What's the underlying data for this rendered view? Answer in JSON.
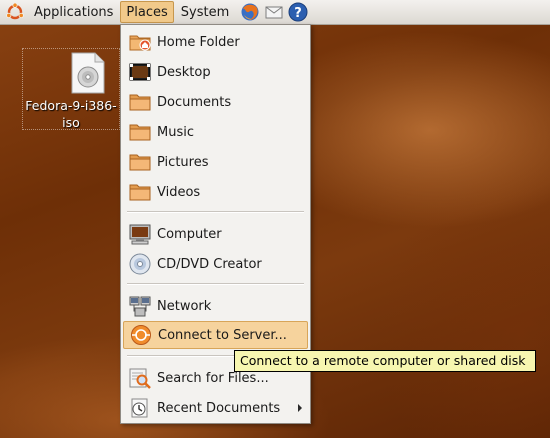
{
  "panel": {
    "applications_label": "Applications",
    "places_label": "Places",
    "system_label": "System",
    "launchers": [
      "firefox-icon",
      "mail-icon",
      "help-icon"
    ]
  },
  "desktop": {
    "icons": [
      {
        "label_line1": "Fedora-9-i386-",
        "label_line2": "iso",
        "icon": "disc-image-icon"
      }
    ]
  },
  "places_menu": {
    "items": [
      {
        "label": "Home Folder",
        "icon": "home-folder-icon"
      },
      {
        "label": "Desktop",
        "icon": "desktop-icon"
      },
      {
        "label": "Documents",
        "icon": "folder-icon"
      },
      {
        "label": "Music",
        "icon": "folder-icon"
      },
      {
        "label": "Pictures",
        "icon": "folder-icon"
      },
      {
        "label": "Videos",
        "icon": "folder-icon"
      },
      {
        "label": "Computer",
        "icon": "computer-icon"
      },
      {
        "label": "CD/DVD Creator",
        "icon": "cd-dvd-icon"
      },
      {
        "label": "Network",
        "icon": "network-icon"
      },
      {
        "label": "Connect to Server...",
        "icon": "connect-server-icon",
        "highlighted": true
      },
      {
        "label": "Search for Files...",
        "icon": "search-icon"
      },
      {
        "label": "Recent Documents",
        "icon": "recent-documents-icon",
        "has_submenu": true
      }
    ]
  },
  "tooltip": {
    "text": "Connect to a remote computer or shared disk"
  },
  "colors": {
    "menu_highlight": "#f6d39d",
    "panel_active": "#f1c98a",
    "tooltip_bg": "#f7f6b0",
    "desktop_base": "#6e2f07"
  }
}
